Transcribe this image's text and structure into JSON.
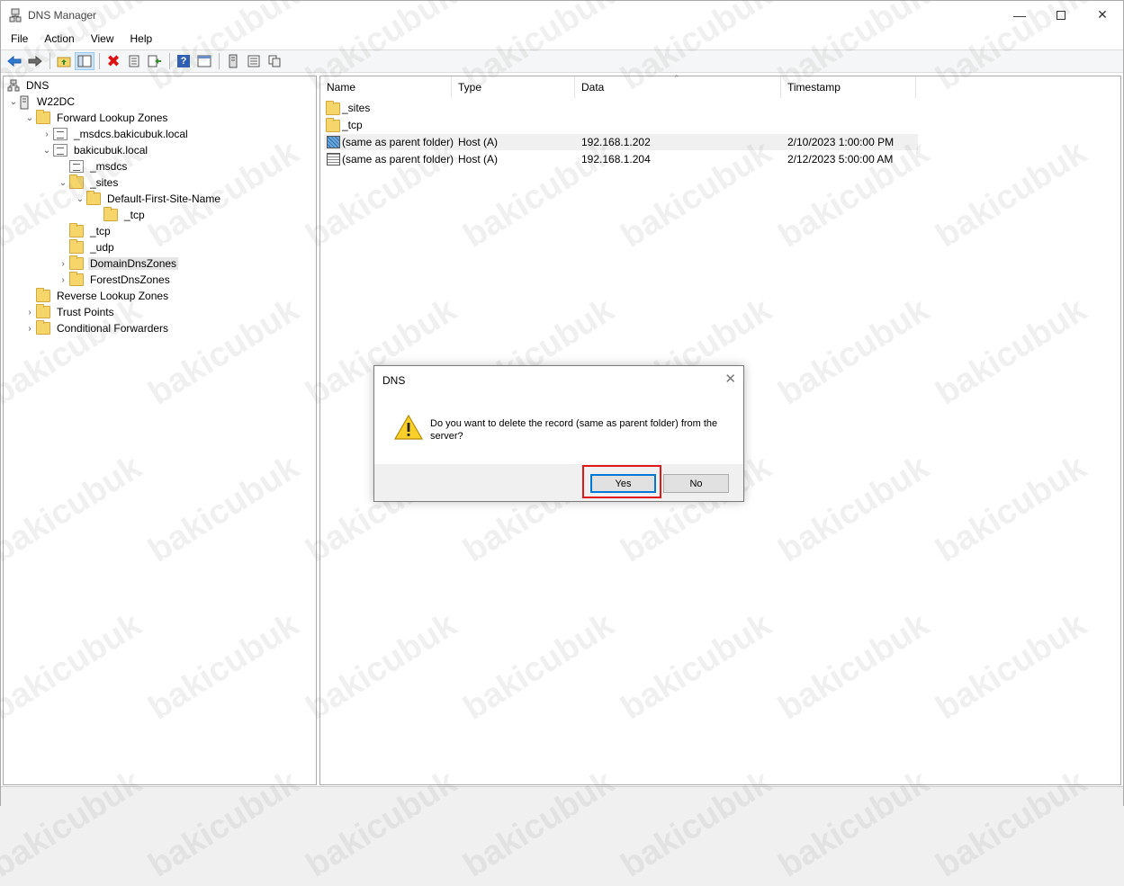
{
  "window": {
    "title": "DNS Manager"
  },
  "menu": [
    "File",
    "Action",
    "View",
    "Help"
  ],
  "tree": {
    "root": "DNS",
    "server": "W22DC",
    "forward": "Forward Lookup Zones",
    "msdcs_zone": "_msdcs.bakicubuk.local",
    "zone": "bakicubuk.local",
    "msdcs": "_msdcs",
    "sites": "_sites",
    "default_site": "Default-First-Site-Name",
    "site_tcp": "_tcp",
    "tcp": "_tcp",
    "udp": "_udp",
    "domaindns": "DomainDnsZones",
    "forestdns": "ForestDnsZones",
    "reverse": "Reverse Lookup Zones",
    "trust": "Trust Points",
    "conditional": "Conditional Forwarders"
  },
  "columns": [
    "Name",
    "Type",
    "Data",
    "Timestamp"
  ],
  "rows": [
    {
      "name": "_sites",
      "type": "",
      "data": "",
      "timestamp": ""
    },
    {
      "name": "_tcp",
      "type": "",
      "data": "",
      "timestamp": ""
    },
    {
      "name": "(same as parent folder)",
      "type": "Host (A)",
      "data": "192.168.1.202",
      "timestamp": "2/10/2023 1:00:00 PM"
    },
    {
      "name": "(same as parent folder)",
      "type": "Host (A)",
      "data": "192.168.1.204",
      "timestamp": "2/12/2023 5:00:00 AM"
    }
  ],
  "dialog": {
    "title": "DNS",
    "message": "Do you want to delete the record (same as parent folder) from the server?",
    "yes": "Yes",
    "no": "No"
  },
  "watermark": "bakicubuk"
}
